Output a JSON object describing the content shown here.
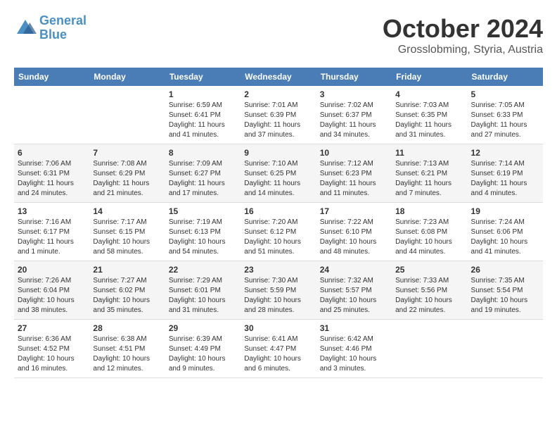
{
  "logo": {
    "line1": "General",
    "line2": "Blue"
  },
  "title": "October 2024",
  "subtitle": "Grosslobming, Styria, Austria",
  "weekdays": [
    "Sunday",
    "Monday",
    "Tuesday",
    "Wednesday",
    "Thursday",
    "Friday",
    "Saturday"
  ],
  "weeks": [
    [
      {
        "day": "",
        "info": ""
      },
      {
        "day": "",
        "info": ""
      },
      {
        "day": "1",
        "info": "Sunrise: 6:59 AM\nSunset: 6:41 PM\nDaylight: 11 hours and 41 minutes."
      },
      {
        "day": "2",
        "info": "Sunrise: 7:01 AM\nSunset: 6:39 PM\nDaylight: 11 hours and 37 minutes."
      },
      {
        "day": "3",
        "info": "Sunrise: 7:02 AM\nSunset: 6:37 PM\nDaylight: 11 hours and 34 minutes."
      },
      {
        "day": "4",
        "info": "Sunrise: 7:03 AM\nSunset: 6:35 PM\nDaylight: 11 hours and 31 minutes."
      },
      {
        "day": "5",
        "info": "Sunrise: 7:05 AM\nSunset: 6:33 PM\nDaylight: 11 hours and 27 minutes."
      }
    ],
    [
      {
        "day": "6",
        "info": "Sunrise: 7:06 AM\nSunset: 6:31 PM\nDaylight: 11 hours and 24 minutes."
      },
      {
        "day": "7",
        "info": "Sunrise: 7:08 AM\nSunset: 6:29 PM\nDaylight: 11 hours and 21 minutes."
      },
      {
        "day": "8",
        "info": "Sunrise: 7:09 AM\nSunset: 6:27 PM\nDaylight: 11 hours and 17 minutes."
      },
      {
        "day": "9",
        "info": "Sunrise: 7:10 AM\nSunset: 6:25 PM\nDaylight: 11 hours and 14 minutes."
      },
      {
        "day": "10",
        "info": "Sunrise: 7:12 AM\nSunset: 6:23 PM\nDaylight: 11 hours and 11 minutes."
      },
      {
        "day": "11",
        "info": "Sunrise: 7:13 AM\nSunset: 6:21 PM\nDaylight: 11 hours and 7 minutes."
      },
      {
        "day": "12",
        "info": "Sunrise: 7:14 AM\nSunset: 6:19 PM\nDaylight: 11 hours and 4 minutes."
      }
    ],
    [
      {
        "day": "13",
        "info": "Sunrise: 7:16 AM\nSunset: 6:17 PM\nDaylight: 11 hours and 1 minute."
      },
      {
        "day": "14",
        "info": "Sunrise: 7:17 AM\nSunset: 6:15 PM\nDaylight: 10 hours and 58 minutes."
      },
      {
        "day": "15",
        "info": "Sunrise: 7:19 AM\nSunset: 6:13 PM\nDaylight: 10 hours and 54 minutes."
      },
      {
        "day": "16",
        "info": "Sunrise: 7:20 AM\nSunset: 6:12 PM\nDaylight: 10 hours and 51 minutes."
      },
      {
        "day": "17",
        "info": "Sunrise: 7:22 AM\nSunset: 6:10 PM\nDaylight: 10 hours and 48 minutes."
      },
      {
        "day": "18",
        "info": "Sunrise: 7:23 AM\nSunset: 6:08 PM\nDaylight: 10 hours and 44 minutes."
      },
      {
        "day": "19",
        "info": "Sunrise: 7:24 AM\nSunset: 6:06 PM\nDaylight: 10 hours and 41 minutes."
      }
    ],
    [
      {
        "day": "20",
        "info": "Sunrise: 7:26 AM\nSunset: 6:04 PM\nDaylight: 10 hours and 38 minutes."
      },
      {
        "day": "21",
        "info": "Sunrise: 7:27 AM\nSunset: 6:02 PM\nDaylight: 10 hours and 35 minutes."
      },
      {
        "day": "22",
        "info": "Sunrise: 7:29 AM\nSunset: 6:01 PM\nDaylight: 10 hours and 31 minutes."
      },
      {
        "day": "23",
        "info": "Sunrise: 7:30 AM\nSunset: 5:59 PM\nDaylight: 10 hours and 28 minutes."
      },
      {
        "day": "24",
        "info": "Sunrise: 7:32 AM\nSunset: 5:57 PM\nDaylight: 10 hours and 25 minutes."
      },
      {
        "day": "25",
        "info": "Sunrise: 7:33 AM\nSunset: 5:56 PM\nDaylight: 10 hours and 22 minutes."
      },
      {
        "day": "26",
        "info": "Sunrise: 7:35 AM\nSunset: 5:54 PM\nDaylight: 10 hours and 19 minutes."
      }
    ],
    [
      {
        "day": "27",
        "info": "Sunrise: 6:36 AM\nSunset: 4:52 PM\nDaylight: 10 hours and 16 minutes."
      },
      {
        "day": "28",
        "info": "Sunrise: 6:38 AM\nSunset: 4:51 PM\nDaylight: 10 hours and 12 minutes."
      },
      {
        "day": "29",
        "info": "Sunrise: 6:39 AM\nSunset: 4:49 PM\nDaylight: 10 hours and 9 minutes."
      },
      {
        "day": "30",
        "info": "Sunrise: 6:41 AM\nSunset: 4:47 PM\nDaylight: 10 hours and 6 minutes."
      },
      {
        "day": "31",
        "info": "Sunrise: 6:42 AM\nSunset: 4:46 PM\nDaylight: 10 hours and 3 minutes."
      },
      {
        "day": "",
        "info": ""
      },
      {
        "day": "",
        "info": ""
      }
    ]
  ]
}
